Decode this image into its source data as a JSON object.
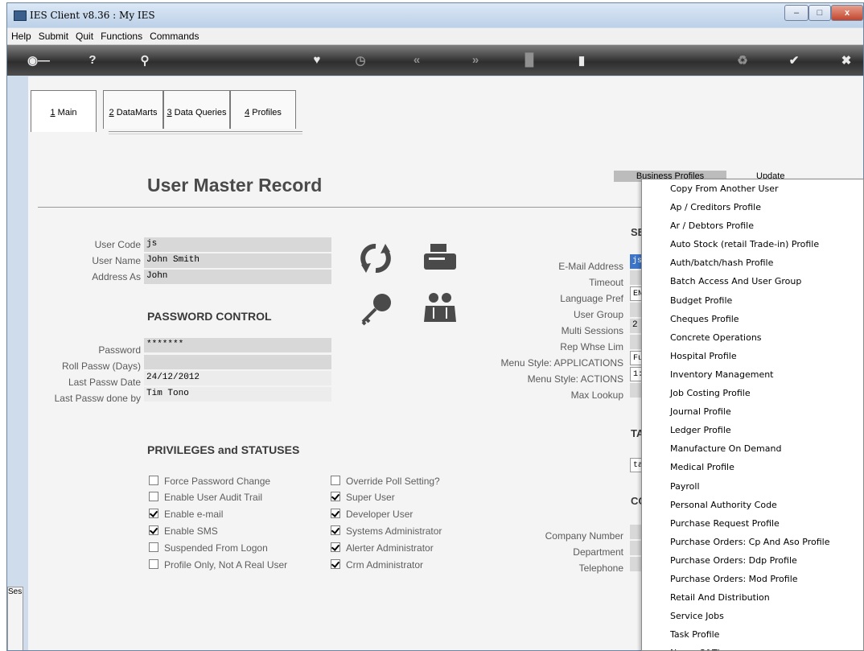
{
  "window": {
    "title": "IES Client v8.36 : My IES",
    "minimize": "–",
    "maximize": "□",
    "close": "x"
  },
  "menu": [
    "Help",
    "Submit",
    "Quit",
    "Functions",
    "Commands"
  ],
  "toolbar_icons": [
    "key-icon",
    "help-icon",
    "search-icon",
    "heart-icon",
    "clock-icon",
    "rewind-icon",
    "fast-forward-icon",
    "tool-icon",
    "page-icon",
    "recycle-icon",
    "check-icon",
    "close-icon"
  ],
  "tabs": [
    {
      "num": "1",
      "label": " Main"
    },
    {
      "num": "2",
      "label": " DataMarts"
    },
    {
      "num": "3",
      "label": " Data Queries"
    },
    {
      "num": "4",
      "label": " Profiles"
    }
  ],
  "page": {
    "heading": "User Master Record",
    "business_profiles_btn": "Business Profiles",
    "update_btn": "Update"
  },
  "user": {
    "code_label": "User Code",
    "code": "js",
    "name_label": "User Name",
    "name": "John Smith",
    "address_label": "Address As",
    "address": "John"
  },
  "password": {
    "heading": "PASSWORD CONTROL",
    "password_label": "Password",
    "password": "*******",
    "roll_label": "Roll Passw (Days)",
    "roll": "",
    "last_date_label": "Last Passw Date",
    "last_date": "24/12/2012",
    "last_by_label": "Last Passw done by",
    "last_by": "Tim Tono"
  },
  "settings": {
    "heading": "SE",
    "email_label": "E-Mail Address",
    "email": "js@",
    "timeout_label": "Timeout",
    "timeout": "",
    "lang_label": "Language Pref",
    "lang": "EN",
    "group_label": "User Group",
    "group": "",
    "multi_label": "Multi Sessions",
    "multi": "2",
    "rep_label": "Rep Whse Lim",
    "rep": "",
    "menu_apps_label": "Menu Style: APPLICATIONS",
    "menu_apps": "Fu",
    "menu_actions_label": "Menu Style: ACTIONS",
    "menu_actions": "1:",
    "max_lookup_label": "Max Lookup",
    "max_lookup": ""
  },
  "ta": {
    "heading": "TA",
    "value": "ta"
  },
  "co": {
    "heading": "CO",
    "company_label": "Company Number",
    "department_label": "Department",
    "telephone_label": "Telephone"
  },
  "privileges": {
    "heading": "PRIVILEGES and STATUSES",
    "left": [
      {
        "label": "Force Password Change",
        "checked": false
      },
      {
        "label": "Enable User Audit Trail",
        "checked": false
      },
      {
        "label": "Enable e-mail",
        "checked": true
      },
      {
        "label": "Enable SMS",
        "checked": true
      },
      {
        "label": "Suspended From Logon",
        "checked": false
      },
      {
        "label": "Profile Only, Not A Real User",
        "checked": false
      }
    ],
    "right": [
      {
        "label": "Override Poll Setting?",
        "checked": false
      },
      {
        "label": "Super User",
        "checked": true
      },
      {
        "label": "Developer User",
        "checked": true
      },
      {
        "label": "Systems Administrator",
        "checked": true
      },
      {
        "label": "Alerter Administrator",
        "checked": true
      },
      {
        "label": "Crm Administrator",
        "checked": true
      }
    ]
  },
  "profile_menu": [
    "Copy From Another User",
    "Ap / Creditors Profile",
    "Ar / Debtors Profile",
    "Auto Stock (retail Trade-in) Profile",
    "Auth/batch/hash Profile",
    "Batch Access And User Group",
    "Budget Profile",
    "Cheques Profile",
    "Concrete Operations",
    "Hospital Profile",
    "Inventory Management",
    "Job Costing Profile",
    "Journal Profile",
    "Ledger Profile",
    "Manufacture On Demand",
    "Medical Profile",
    "Payroll",
    "Personal Authority Code",
    "Purchase Request Profile",
    "Purchase Orders: Cp And Aso Profile",
    "Purchase Orders: Ddp Profile",
    "Purchase Orders: Mod Profile",
    "Retail And Distribution",
    "Service Jobs",
    "Task Profile",
    "Name Of Th..."
  ],
  "side": {
    "ses_label": "Ses"
  }
}
